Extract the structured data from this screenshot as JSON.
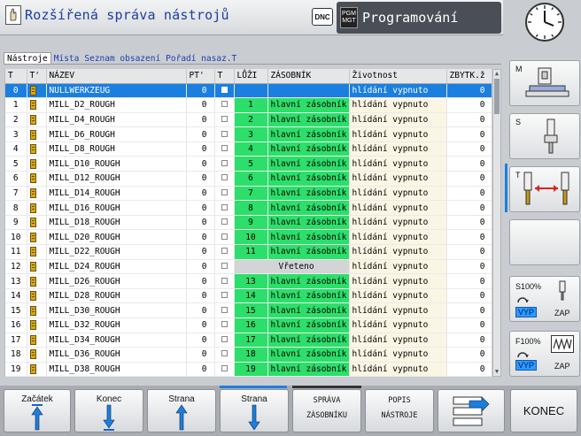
{
  "header": {
    "title": "Rozšířená správa nástrojů",
    "dnc_label": "DNC",
    "mode_icon": "PGM MGT",
    "program_mode": "Programování"
  },
  "tabs": [
    {
      "label": "Nástroje",
      "active": true
    },
    {
      "label": "Místa",
      "active": false
    },
    {
      "label": "Seznam obsazení",
      "active": false
    },
    {
      "label": "Pořadí nasaz.T",
      "active": false
    }
  ],
  "table": {
    "headers": [
      "T",
      "T'",
      "NÁZEV",
      "PT'",
      "T",
      "LŮŽI",
      "ZÁSOBNÍK",
      "Životnost",
      "ZBYTK.ž"
    ],
    "rows": [
      {
        "t": "0",
        "name": "NULLWERKZEUG",
        "pt": "0",
        "luzi": "",
        "zas": "",
        "ziv": "hlídání vypnuto",
        "zb": "0",
        "selected": true,
        "spindle": false
      },
      {
        "t": "1",
        "name": "MILL_D2_ROUGH",
        "pt": "0",
        "luzi": "1",
        "zas": "hlavní zásobník",
        "ziv": "hlídání vypnuto",
        "zb": "0"
      },
      {
        "t": "2",
        "name": "MILL_D4_ROUGH",
        "pt": "0",
        "luzi": "2",
        "zas": "hlavní zásobník",
        "ziv": "hlídání vypnuto",
        "zb": "0"
      },
      {
        "t": "3",
        "name": "MILL_D6_ROUGH",
        "pt": "0",
        "luzi": "3",
        "zas": "hlavní zásobník",
        "ziv": "hlídání vypnuto",
        "zb": "0"
      },
      {
        "t": "4",
        "name": "MILL_D8_ROUGH",
        "pt": "0",
        "luzi": "4",
        "zas": "hlavní zásobník",
        "ziv": "hlídání vypnuto",
        "zb": "0"
      },
      {
        "t": "5",
        "name": "MILL_D10_ROUGH",
        "pt": "0",
        "luzi": "5",
        "zas": "hlavní zásobník",
        "ziv": "hlídání vypnuto",
        "zb": "0"
      },
      {
        "t": "6",
        "name": "MILL_D12_ROUGH",
        "pt": "0",
        "luzi": "6",
        "zas": "hlavní zásobník",
        "ziv": "hlídání vypnuto",
        "zb": "0"
      },
      {
        "t": "7",
        "name": "MILL_D14_ROUGH",
        "pt": "0",
        "luzi": "7",
        "zas": "hlavní zásobník",
        "ziv": "hlídání vypnuto",
        "zb": "0"
      },
      {
        "t": "8",
        "name": "MILL_D16_ROUGH",
        "pt": "0",
        "luzi": "8",
        "zas": "hlavní zásobník",
        "ziv": "hlídání vypnuto",
        "zb": "0"
      },
      {
        "t": "9",
        "name": "MILL_D18_ROUGH",
        "pt": "0",
        "luzi": "9",
        "zas": "hlavní zásobník",
        "ziv": "hlídání vypnuto",
        "zb": "0"
      },
      {
        "t": "10",
        "name": "MILL_D20_ROUGH",
        "pt": "0",
        "luzi": "10",
        "zas": "hlavní zásobník",
        "ziv": "hlídání vypnuto",
        "zb": "0"
      },
      {
        "t": "11",
        "name": "MILL_D22_ROUGH",
        "pt": "0",
        "luzi": "11",
        "zas": "hlavní zásobník",
        "ziv": "hlídání vypnuto",
        "zb": "0"
      },
      {
        "t": "12",
        "name": "MILL_D24_ROUGH",
        "pt": "0",
        "luzi": "",
        "zas": "Vřeteno",
        "ziv": "hlídání vypnuto",
        "zb": "0",
        "spindle": true
      },
      {
        "t": "13",
        "name": "MILL_D26_ROUGH",
        "pt": "0",
        "luzi": "13",
        "zas": "hlavní zásobník",
        "ziv": "hlídání vypnuto",
        "zb": "0"
      },
      {
        "t": "14",
        "name": "MILL_D28_ROUGH",
        "pt": "0",
        "luzi": "14",
        "zas": "hlavní zásobník",
        "ziv": "hlídání vypnuto",
        "zb": "0"
      },
      {
        "t": "15",
        "name": "MILL_D30_ROUGH",
        "pt": "0",
        "luzi": "15",
        "zas": "hlavní zásobník",
        "ziv": "hlídání vypnuto",
        "zb": "0"
      },
      {
        "t": "16",
        "name": "MILL_D32_ROUGH",
        "pt": "0",
        "luzi": "16",
        "zas": "hlavní zásobník",
        "ziv": "hlídání vypnuto",
        "zb": "0"
      },
      {
        "t": "17",
        "name": "MILL_D34_ROUGH",
        "pt": "0",
        "luzi": "17",
        "zas": "hlavní zásobník",
        "ziv": "hlídání vypnuto",
        "zb": "0"
      },
      {
        "t": "18",
        "name": "MILL_D36_ROUGH",
        "pt": "0",
        "luzi": "18",
        "zas": "hlavní zásobník",
        "ziv": "hlídání vypnuto",
        "zb": "0"
      },
      {
        "t": "19",
        "name": "MILL_D38_ROUGH",
        "pt": "0",
        "luzi": "19",
        "zas": "hlavní zásobník",
        "ziv": "hlídání vypnuto",
        "zb": "0"
      }
    ]
  },
  "side": {
    "m_letter": "M",
    "s_letter": "S",
    "t_letter": "T",
    "s_override": "S100%",
    "f_override": "F100%",
    "vyp": "VYP",
    "zap": "ZAP"
  },
  "softkeys": {
    "start": "Začátek",
    "end": "Konec",
    "page_up": "Strana",
    "page_down": "Strana",
    "pocket_line1": "SPRÁVA",
    "pocket_line2": "ZÁSOBNÍKU",
    "desc_line1": "POPIS",
    "desc_line2": "NÁSTROJE",
    "exit": "KONEC"
  },
  "colors": {
    "accent_blue": "#1b7fe0",
    "pocket_green": "#2bdf6a",
    "title_blue": "#1a3fa6"
  }
}
